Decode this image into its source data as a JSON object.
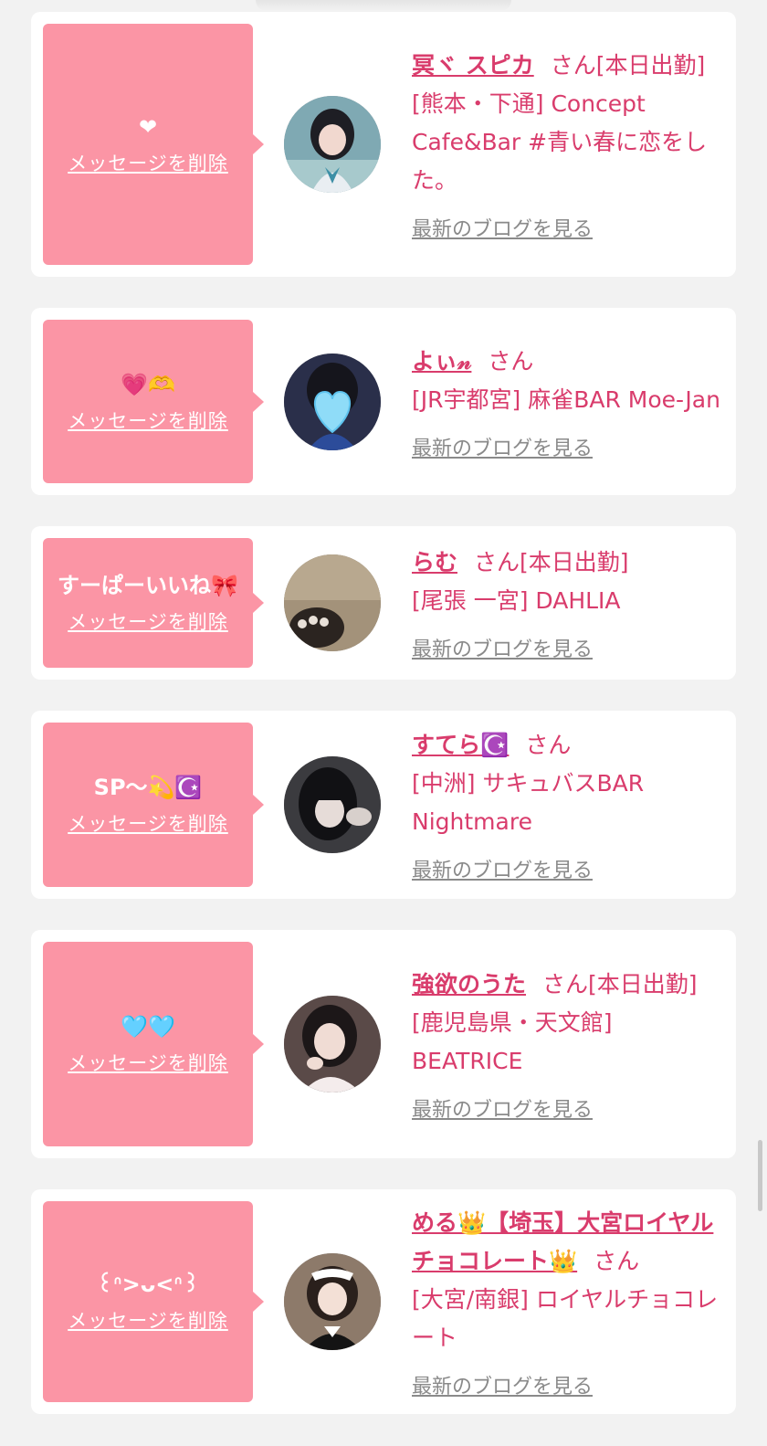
{
  "common": {
    "san": "さん",
    "delete_label": "メッセージを削除",
    "blog_label": "最新のブログを見る"
  },
  "cards": [
    {
      "message": "❤",
      "name": "冥ヾ スピカ",
      "status": "[本日出勤]",
      "shop": "[熊本・下通] Concept Cafe&Bar #青い春に恋をした。"
    },
    {
      "message": "💗🫶",
      "name": "よぃ𝓃",
      "status": "",
      "shop": "[JR宇都宮] 麻雀BAR Moe-Jan"
    },
    {
      "message": "すーぱーいいね🎀",
      "name": "らむ",
      "status": "[本日出勤]",
      "shop": "[尾張 一宮] DAHLIA"
    },
    {
      "message": "SP〜💫☪️",
      "name": "すてら☪️",
      "status": "",
      "shop": "[中洲] サキュバスBAR Nightmare"
    },
    {
      "message": "🩵🩵",
      "name": "強欲のうた",
      "status": "[本日出勤]",
      "shop": "[鹿児島県・天文館] BEATRICE"
    },
    {
      "message": "꒰ᐢ>ᴗ<ᐢ꒱",
      "name": "める👑【埼玉】大宮ロイヤルチョコレート👑",
      "status": "",
      "shop": "[大宮/南銀] ロイヤルチョコレート"
    }
  ],
  "colors": {
    "bubble": "#fb95a5",
    "accent_text": "#d93c6c",
    "link_gray": "#8a8a8a",
    "page_bg": "#f2f2f2"
  }
}
